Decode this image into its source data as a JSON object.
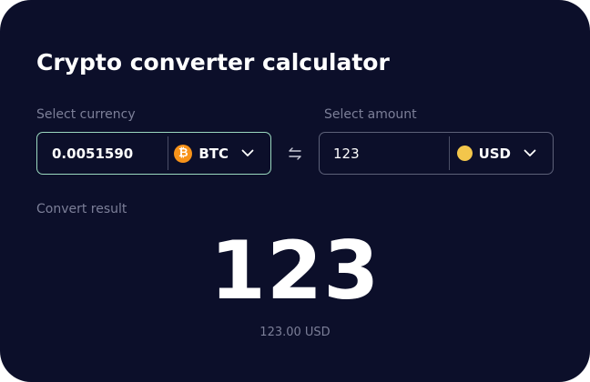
{
  "title": "Crypto converter calculator",
  "from": {
    "label": "Select currency",
    "amount": "0.0051590",
    "currency_code": "BTC",
    "currency_symbol": "₿",
    "currency_icon": "bitcoin-icon"
  },
  "to": {
    "label": "Select amount",
    "amount": "123",
    "currency_code": "USD",
    "currency_icon": "usd-coin-icon"
  },
  "result": {
    "label": "Convert result",
    "value": "123",
    "formatted": "123.00 USD"
  },
  "colors": {
    "background": "#0c0f2a",
    "accent_border": "#9bd8bf",
    "muted_text": "#7c7f98",
    "bitcoin": "#f7931a",
    "usd_coin": "#f3c64b"
  }
}
